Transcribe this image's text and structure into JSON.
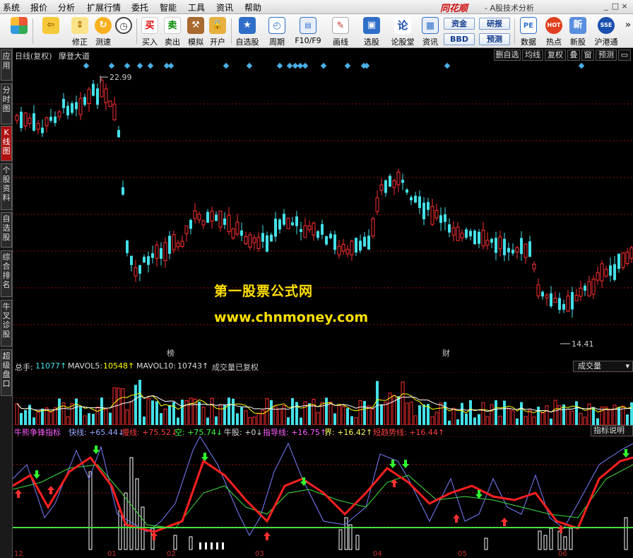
{
  "menubar": {
    "items": [
      "系统",
      "报价",
      "分析",
      "扩展行情",
      "委托",
      "智能",
      "工具",
      "资讯",
      "帮助"
    ],
    "logo": "同花顺",
    "subtitle": "- A股技术分析"
  },
  "toolbar": {
    "buttons": [
      {
        "label": "",
        "icon": "grid-icon"
      },
      {
        "label": "",
        "icon": "back-arrow-icon"
      },
      {
        "label": "修正",
        "icon": "up-down-arrow-icon"
      },
      {
        "label": "测速",
        "icon": "refresh-icon"
      },
      {
        "label": "",
        "icon": "clock-icon"
      },
      {
        "label": "买入",
        "icon": "buy-icon",
        "glyph": "买"
      },
      {
        "label": "卖出",
        "icon": "sell-icon",
        "glyph": "卖"
      },
      {
        "label": "模拟",
        "icon": "hammer-icon"
      },
      {
        "label": "开户",
        "icon": "lock-icon"
      },
      {
        "label": "自选股",
        "icon": "star-icon"
      },
      {
        "label": "周期",
        "icon": "cycle-icon"
      },
      {
        "label": "F10/F9",
        "icon": "f10-icon"
      },
      {
        "label": "画线",
        "icon": "pen-icon"
      },
      {
        "label": "选股",
        "icon": "select-stock-icon"
      },
      {
        "label": "论股堂",
        "icon": "forum-icon",
        "glyph": "论"
      },
      {
        "label": "资讯",
        "icon": "news-icon"
      },
      {
        "label": "数据",
        "icon": "pe-icon",
        "glyph": "PE"
      },
      {
        "label": "热点",
        "icon": "hot-icon",
        "glyph": "HOT"
      },
      {
        "label": "新股",
        "icon": "new-stock-icon",
        "glyph": "新"
      },
      {
        "label": "沪港通",
        "icon": "sse-hk-icon",
        "glyph": "SSE"
      }
    ],
    "small_buttons": {
      "funds": "资金",
      "research": "研报",
      "bbd": "BBD",
      "forecast": "预测"
    }
  },
  "left_tabs": [
    "应用",
    "分时图",
    "K线图",
    "个股资料",
    "自选股",
    "综合排名",
    "牛叉诊股",
    "超级盘口"
  ],
  "chart_header": {
    "period": "日线(复权)",
    "indicator_name": "摩登大道",
    "buttons": [
      "删自选",
      "均线",
      "复权",
      "叠",
      "窗",
      "预测"
    ]
  },
  "main_chart": {
    "high_label": "22.99",
    "low_label": "14.41",
    "marker_bang": "榜",
    "marker_cai": "财",
    "watermark_title": "第一股票公式网",
    "watermark_url": "www.chnmoney.com"
  },
  "volume_panel": {
    "total_label": "总手:",
    "total_value": "11077↑",
    "mavol5_label": "MAVOL5:",
    "mavol5_value": "10548↑",
    "mavol10_label": "MAVOL10:",
    "mavol10_value": "10743↑",
    "note": "成交量已复权",
    "dropdown": "成交量"
  },
  "indicator_panel": {
    "name": "牛熊争锋指标",
    "fast": "快线: +65.44↓",
    "slow": "慢线: +75.52↓",
    "empty": "空: +75.74↓",
    "bull": "牛股: +0↓",
    "guide": "指导线: +16.75↑",
    "bound": "界: +16.42↑",
    "short_trend": "短趋势线: +16.44↑",
    "help_button": "指标说明"
  },
  "x_axis": [
    "12",
    "01",
    "02",
    "03",
    "04",
    "05",
    "06"
  ],
  "colors": {
    "up": "#ff3030",
    "down": "#44e0e8",
    "grid": "#8b1010",
    "yellow": "#ffff00",
    "accent": "#b01010"
  }
}
